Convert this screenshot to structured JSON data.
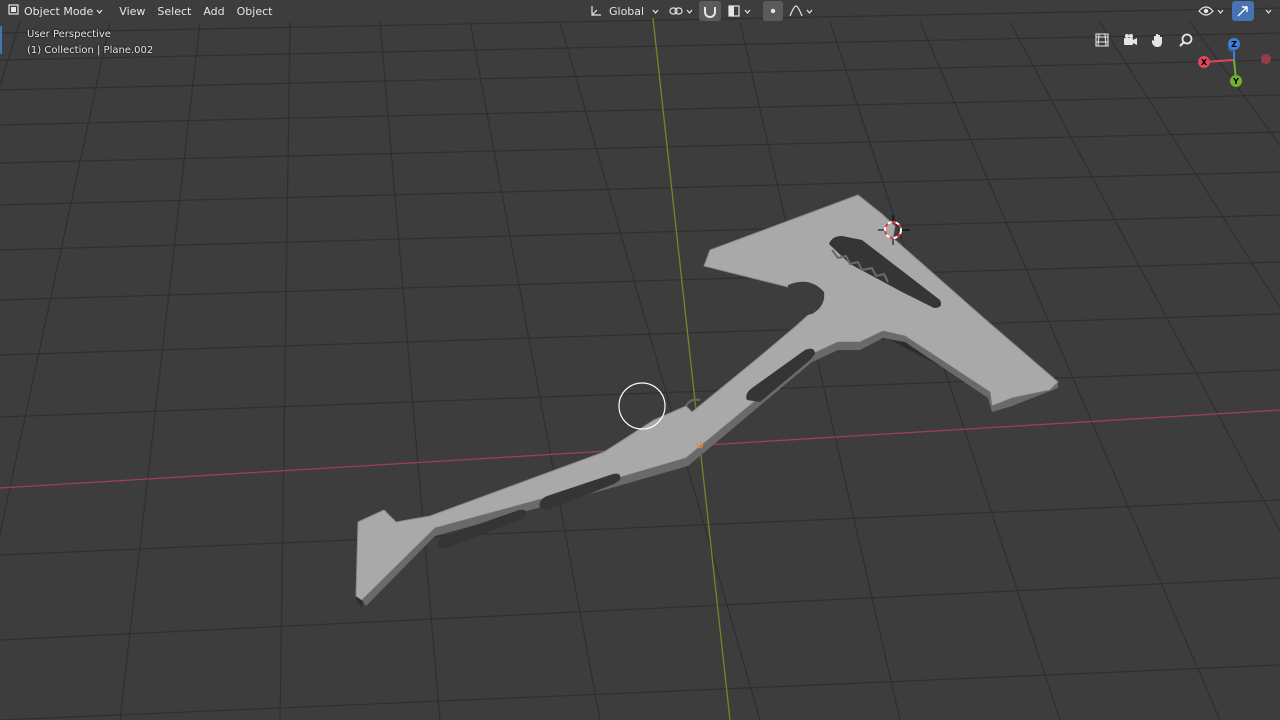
{
  "header": {
    "mode_label": "Object Mode",
    "menus": [
      "View",
      "Select",
      "Add",
      "Object"
    ],
    "transform_orientation": "Global"
  },
  "overlay_info": {
    "line1": "User Perspective",
    "line2": "(1) Collection | Plane.002"
  },
  "gizmo": {
    "x_label": "X",
    "y_label": "Y",
    "z_label": "Z"
  },
  "colors": {
    "background": "#3d3d3d",
    "grid": "#2f2f2f",
    "x_axis": "#9b4152",
    "y_axis": "#6e8a28",
    "object": "#a9a9a9",
    "x_color": "#e0465a",
    "y_color": "#70b32e",
    "z_color": "#3c82d9"
  },
  "icons": {
    "viewport_nav": [
      "grid-view-icon",
      "camera-icon",
      "hand-pan-icon",
      "zoom-icon"
    ]
  }
}
